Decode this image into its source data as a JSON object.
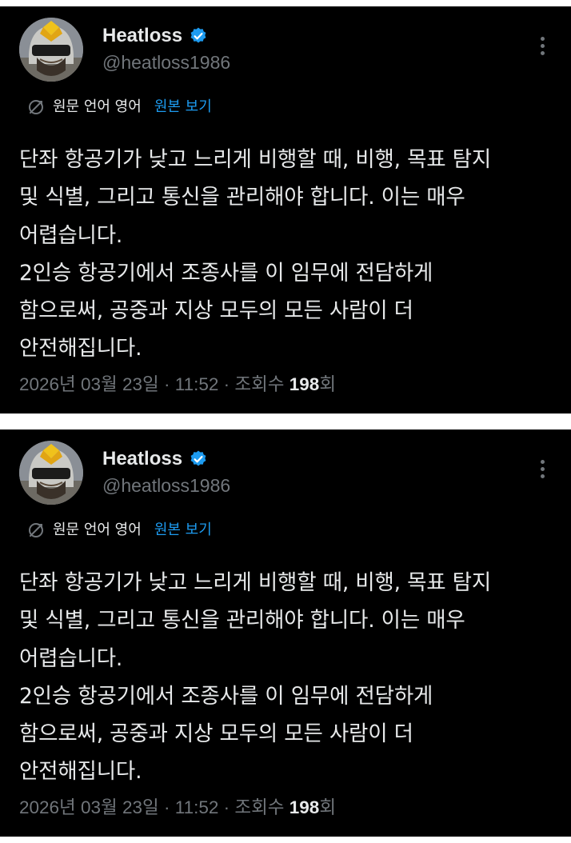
{
  "posts": [
    {
      "author": {
        "display_name": "Heatloss",
        "handle": "@heatloss1986",
        "verified": true,
        "avatar_icon": "pilot-helmet-avatar"
      },
      "translation": {
        "label": "원문 언어 영어",
        "show_original": "원본 보기"
      },
      "text": "단좌 항공기가 낮고 느리게 비행할 때, 비행, 목표 탐지\n및 식별, 그리고 통신을 관리해야 합니다. 이는 매우\n어렵습니다.\n2인승 항공기에서 조종사를 이 임무에 전담하게\n함으로써, 공중과 지상 모두의 모든 사람이 더\n안전해집니다.",
      "meta": {
        "date": "2026년 03월 23일",
        "time": "11:52",
        "views_label": "조회수",
        "views_count": "198",
        "views_suffix": "회"
      }
    },
    {
      "author": {
        "display_name": "Heatloss",
        "handle": "@heatloss1986",
        "verified": true,
        "avatar_icon": "pilot-helmet-avatar"
      },
      "translation": {
        "label": "원문 언어 영어",
        "show_original": "원본 보기"
      },
      "text": "단좌 항공기가 낮고 느리게 비행할 때, 비행, 목표 탐지\n및 식별, 그리고 통신을 관리해야 합니다. 이는 매우\n어렵습니다.\n2인승 항공기에서 조종사를 이 임무에 전담하게\n함으로써, 공중과 지상 모두의 모든 사람이 더\n안전해집니다.",
      "meta": {
        "date": "2026년 03월 23일",
        "time": "11:52",
        "views_label": "조회수",
        "views_count": "198",
        "views_suffix": "회"
      }
    }
  ],
  "colors": {
    "background": "#000000",
    "text": "#e7e9ea",
    "muted": "#71767b",
    "accent": "#1d9bf0",
    "separator": "#ffffff"
  },
  "icons": {
    "verified": "verified-badge-icon",
    "translate": "translate-icon",
    "more": "more-options-icon"
  }
}
